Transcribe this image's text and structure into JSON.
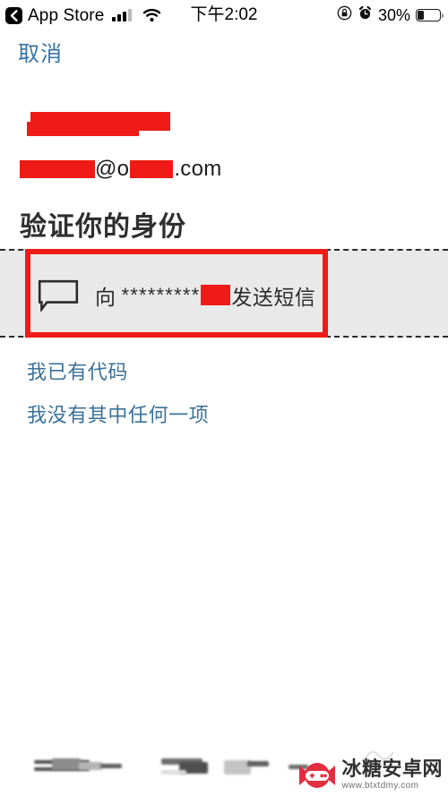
{
  "status_bar": {
    "back_icon": "back-chevron-icon",
    "carrier_label": "App Store",
    "signal_icon": "cellular-signal-icon",
    "wifi_icon": "wifi-icon",
    "time": "下午2:02",
    "rotation_lock_icon": "rotation-lock-icon",
    "alarm_icon": "alarm-clock-icon",
    "battery_percent": "30%",
    "battery_level": 30
  },
  "nav": {
    "cancel_label": "取消"
  },
  "account": {
    "name_redacted": true,
    "email_prefix_redacted": true,
    "email_at": "@",
    "email_domain_head": "o",
    "email_domain_redacted": true,
    "email_suffix": ".com"
  },
  "main": {
    "heading": "验证你的身份",
    "option": {
      "icon": "message-bubble-icon",
      "prefix": "向",
      "masked_number": "*********",
      "number_redacted": true,
      "action": "发送短信"
    },
    "links": [
      {
        "label": "我已有代码",
        "name": "link-have-code"
      },
      {
        "label": "我没有其中任何一项",
        "name": "link-none-of-them"
      }
    ]
  },
  "annotation": {
    "box_color": "#ef1b17",
    "band_color": "#e9e9e9",
    "dash_color": "#2b2b2b",
    "redaction_color": "#ee1b16"
  },
  "theme": {
    "link_color": "#3a7198",
    "cancel_color": "#3573a5",
    "text_color": "#2b2b2b"
  },
  "watermark": {
    "logo_icon": "candy-gamepad-logo-icon",
    "title": "冰糖安卓网",
    "url": "www.btxtdmy.com"
  }
}
